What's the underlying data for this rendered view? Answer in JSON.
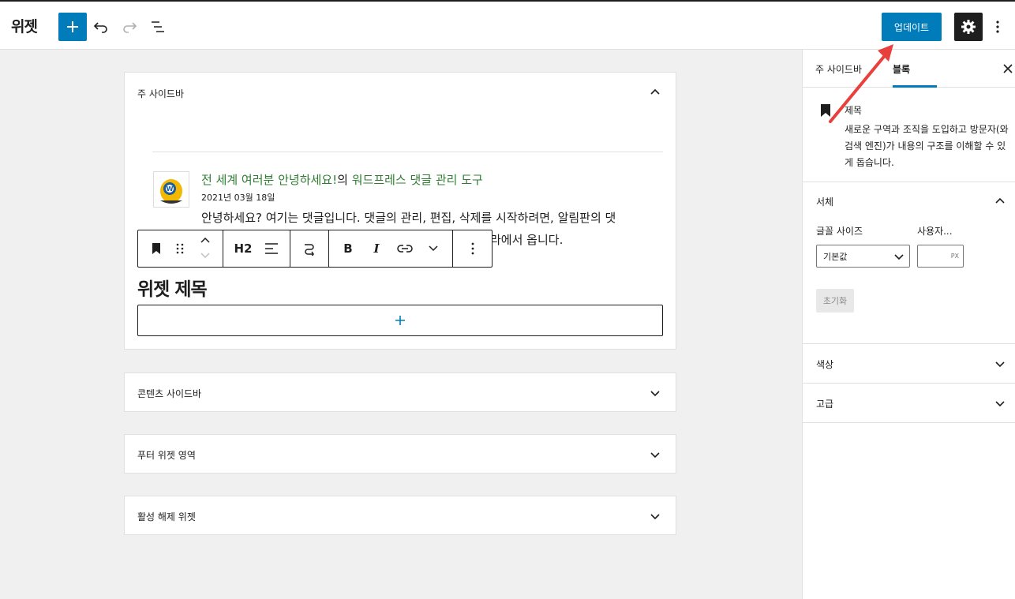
{
  "header": {
    "title": "위젯",
    "update_label": "업데이트"
  },
  "areas": [
    {
      "title": "주 사이드바"
    },
    {
      "title": "콘텐츠 사이드바"
    },
    {
      "title": "푸터 위젯 영역"
    },
    {
      "title": "활성 해제 위젯"
    }
  ],
  "comment": {
    "author_link": "전 세계 여러분 안녕하세요!",
    "connector": "의",
    "post_link": "워드프레스 댓글 관리 도구",
    "date": "2021년 03월 18일",
    "text_line1": "안녕하세요? 여기는 댓글입니다. 댓글의 관리, 편집, 삭제를 시작하려면, 알림판의 댓",
    "text_line2": "라에서 옵니다."
  },
  "toolbar": {
    "heading_level": "H2"
  },
  "widget": {
    "heading": "위젯 제목"
  },
  "sidebar": {
    "tab_main": "주 사이드바",
    "tab_block": "블록",
    "block_title": "제목",
    "block_desc": "새로운 구역과 조직을 도입하고 방문자(와 검색 엔진)가 내용의 구조를 이해할 수 있게 돕습니다.",
    "typography_title": "서체",
    "font_size_label": "글꼴 사이즈",
    "custom_label": "사용자...",
    "font_size_value": "기본값",
    "unit": "PX",
    "reset_label": "초기화",
    "color_title": "색상",
    "advanced_title": "고급"
  },
  "colors": {
    "accent": "#007cba",
    "link": "#2e7d32",
    "arrow": "#e8413d"
  }
}
